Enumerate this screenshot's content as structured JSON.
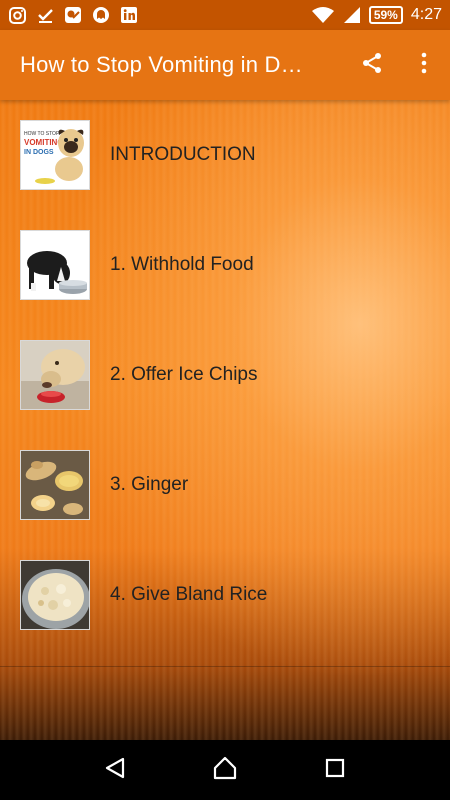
{
  "status_bar": {
    "battery": "59%",
    "time": "4:27",
    "icons": [
      "instagram-icon",
      "download-done-icon",
      "app-icon",
      "ghost-icon",
      "linkedin-icon",
      "wifi-icon",
      "signal-icon",
      "battery-icon"
    ]
  },
  "app_bar": {
    "title": "How to Stop Vomiting in D…",
    "actions": [
      "share-icon",
      "more-vert-icon"
    ]
  },
  "list": {
    "items": [
      {
        "label": "INTRODUCTION",
        "thumb": "intro-dog-thumbnail"
      },
      {
        "label": "1. Withhold Food",
        "thumb": "dog-eating-bowl-thumbnail"
      },
      {
        "label": "2. Offer Ice Chips",
        "thumb": "dog-ice-chips-thumbnail"
      },
      {
        "label": "3. Ginger",
        "thumb": "ginger-root-thumbnail"
      },
      {
        "label": "4. Give Bland Rice",
        "thumb": "rice-bowl-thumbnail"
      }
    ]
  },
  "thumb_text": {
    "line1": "HOW TO STOP",
    "line2": "VOMITING",
    "line3": "IN DOGS"
  },
  "nav_bar": {
    "buttons": [
      "back-icon",
      "home-icon",
      "recents-icon"
    ]
  },
  "colors": {
    "status_bar": "#c35400",
    "app_bar": "#e67413",
    "background": "#f5861c",
    "text": "#222222"
  }
}
